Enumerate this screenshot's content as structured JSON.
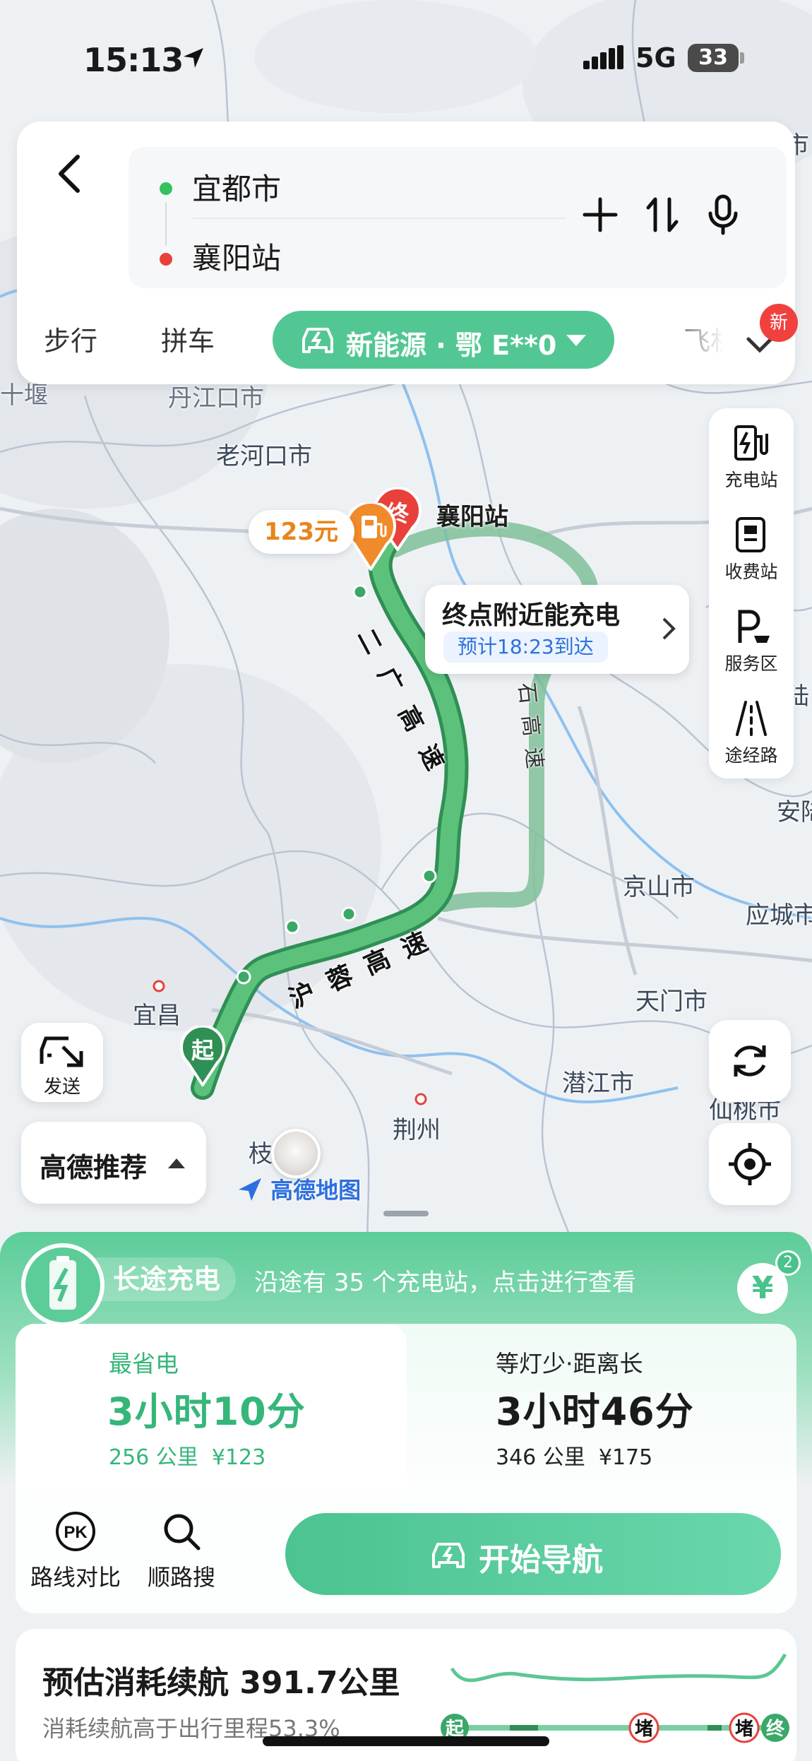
{
  "status_bar": {
    "time": "15:13",
    "network": "5G",
    "battery": "33"
  },
  "search": {
    "from": "宜都市",
    "to": "襄阳站",
    "modes": [
      "步行",
      "拼车"
    ],
    "active_mode": "新能源 · 鄂 E**0",
    "next_mode": "飞机",
    "new_badge": "新"
  },
  "map": {
    "cities": [
      {
        "name": "十堰",
        "dim": true
      },
      {
        "name": "丹江口市",
        "dim": true
      },
      {
        "name": "老河口市"
      },
      {
        "name": "襄阳站"
      },
      {
        "name": "京山市"
      },
      {
        "name": "应城市"
      },
      {
        "name": "安陆"
      },
      {
        "name": "天门市"
      },
      {
        "name": "潜江市"
      },
      {
        "name": "仙桃市"
      },
      {
        "name": "宜昌"
      },
      {
        "name": "荆州"
      },
      {
        "name": "枝"
      },
      {
        "name": "市"
      },
      {
        "name": "陆"
      }
    ],
    "road_labels": [
      "二广高速",
      "沪蓉高速",
      "石高速"
    ],
    "start_label": "起",
    "end_label": "终",
    "price_tag": "123元",
    "info_title": "终点附近能充电",
    "info_eta": "预计18:23到达",
    "logo": "高德地图",
    "send_label": "发送",
    "recommend": "高德推荐"
  },
  "tools": [
    {
      "label": "充电站",
      "icon": "charging-station-icon"
    },
    {
      "label": "收费站",
      "icon": "toll-station-icon"
    },
    {
      "label": "服务区",
      "icon": "service-area-icon"
    },
    {
      "label": "途经路",
      "icon": "via-road-icon"
    }
  ],
  "sheet": {
    "charge_title": "长途充电",
    "charge_desc": "沿途有 35 个充电站，点击进行查看",
    "yuan_count": "2",
    "options": [
      {
        "tag": "最省电",
        "duration": "3小时10分",
        "distance": "256 公里",
        "cost": "¥123"
      },
      {
        "tag": "等灯少·距离长",
        "duration": "3小时46分",
        "distance": "346 公里",
        "cost": "¥175"
      }
    ],
    "compare_label": "路线对比",
    "search_label": "顺路搜",
    "nav_label": "开始导航",
    "pk_text": "PK",
    "consume_title": "预估消耗续航 391.7公里",
    "consume_sub": "消耗续航高于出行里程53.3%",
    "profile_markers": [
      "起",
      "堵",
      "堵",
      "终"
    ]
  },
  "colors": {
    "accent": "#52c793",
    "route_main": "#4fb874",
    "route_alt": "#8ccaa8",
    "end_red": "#e8413b",
    "charger_orange": "#f08a2a"
  }
}
